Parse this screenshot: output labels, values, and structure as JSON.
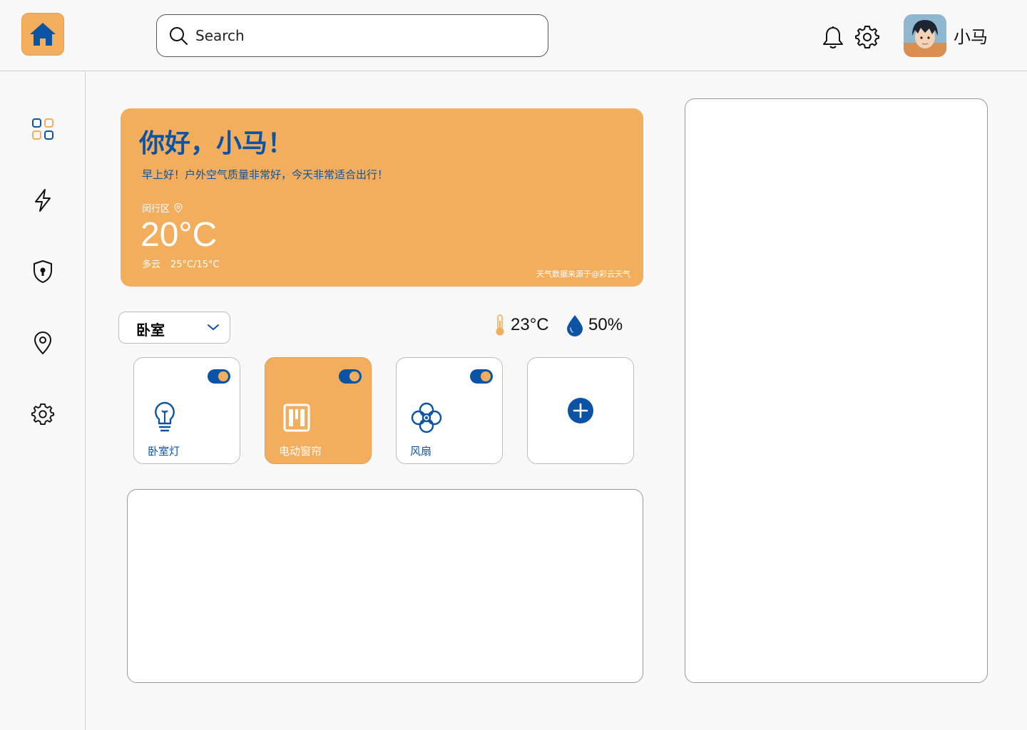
{
  "header": {
    "search_placeholder": "Search",
    "username": "小马"
  },
  "greeting": {
    "title": "你好，小马！",
    "message": "早上好！户外空气质量非常好，今天非常适合出行！",
    "location": "闵行区",
    "temperature": "20°C",
    "condition": "多云",
    "range": "25°C/15°C",
    "source": "天气数据来源于@彩云天气"
  },
  "room": {
    "selected": "卧室",
    "temperature": "23°C",
    "humidity": "50%"
  },
  "devices": [
    {
      "label": "卧室灯",
      "icon": "bulb-icon",
      "on": true,
      "active": false
    },
    {
      "label": "电动窗帘",
      "icon": "curtain-icon",
      "on": true,
      "active": true
    },
    {
      "label": "风扇",
      "icon": "fan-icon",
      "on": true,
      "active": false
    }
  ],
  "colors": {
    "accent": "#f2ad5d",
    "primary": "#0b54a5",
    "background": "#f8f8f8"
  },
  "sidebar": {
    "items": [
      "dashboard-icon",
      "lightning-icon",
      "shield-icon",
      "location-pin-icon",
      "gear-icon"
    ],
    "active": "dashboard-icon"
  }
}
